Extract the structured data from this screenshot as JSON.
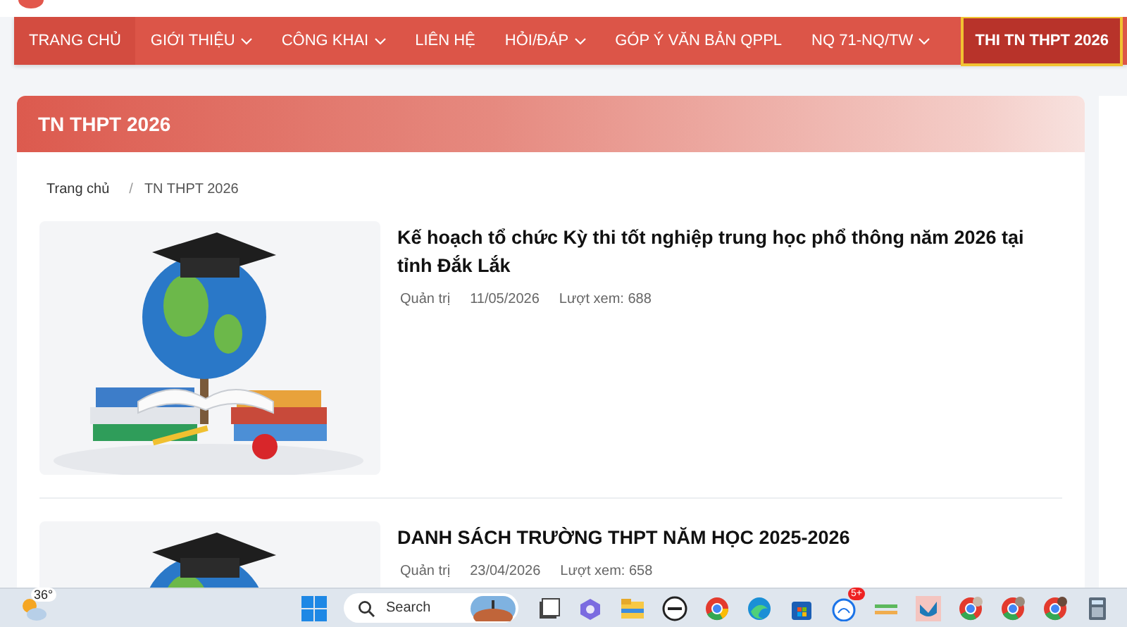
{
  "nav": {
    "items": [
      {
        "label": "TRANG CHỦ",
        "dropdown": false,
        "selected": false
      },
      {
        "label": "GIỚI THIỆU",
        "dropdown": true,
        "selected": false
      },
      {
        "label": "CÔNG KHAI",
        "dropdown": true,
        "selected": false
      },
      {
        "label": "LIÊN HỆ",
        "dropdown": false,
        "selected": false
      },
      {
        "label": "HỎI/ĐÁP",
        "dropdown": true,
        "selected": false
      },
      {
        "label": "GÓP Ý VĂN BẢN QPPL",
        "dropdown": false,
        "selected": false
      },
      {
        "label": "NQ 71-NQ/TW",
        "dropdown": true,
        "selected": false
      },
      {
        "label": "THI TN THPT 2026",
        "dropdown": false,
        "selected": true
      }
    ]
  },
  "page_header": {
    "title": "TN THPT 2026"
  },
  "breadcrumb": [
    "Trang chủ",
    "TN THPT 2026"
  ],
  "breadcrumb_separator": "/",
  "articles": [
    {
      "title": "Kế hoạch tổ chức Kỳ thi tốt nghiệp trung học phổ thông năm 2026 tại tỉnh Đắk Lắk",
      "author": "Quản trị",
      "date": "11/05/2026",
      "views": "Lượt xem: 688"
    },
    {
      "title": "DANH SÁCH TRƯỜNG THPT NĂM HỌC 2025-2026",
      "author": "Quản trị",
      "date": "23/04/2026",
      "views": "Lượt xem: 658"
    }
  ],
  "taskbar": {
    "weather_temp": "36°",
    "search_placeholder": "Search",
    "chat_badge": "5+"
  }
}
